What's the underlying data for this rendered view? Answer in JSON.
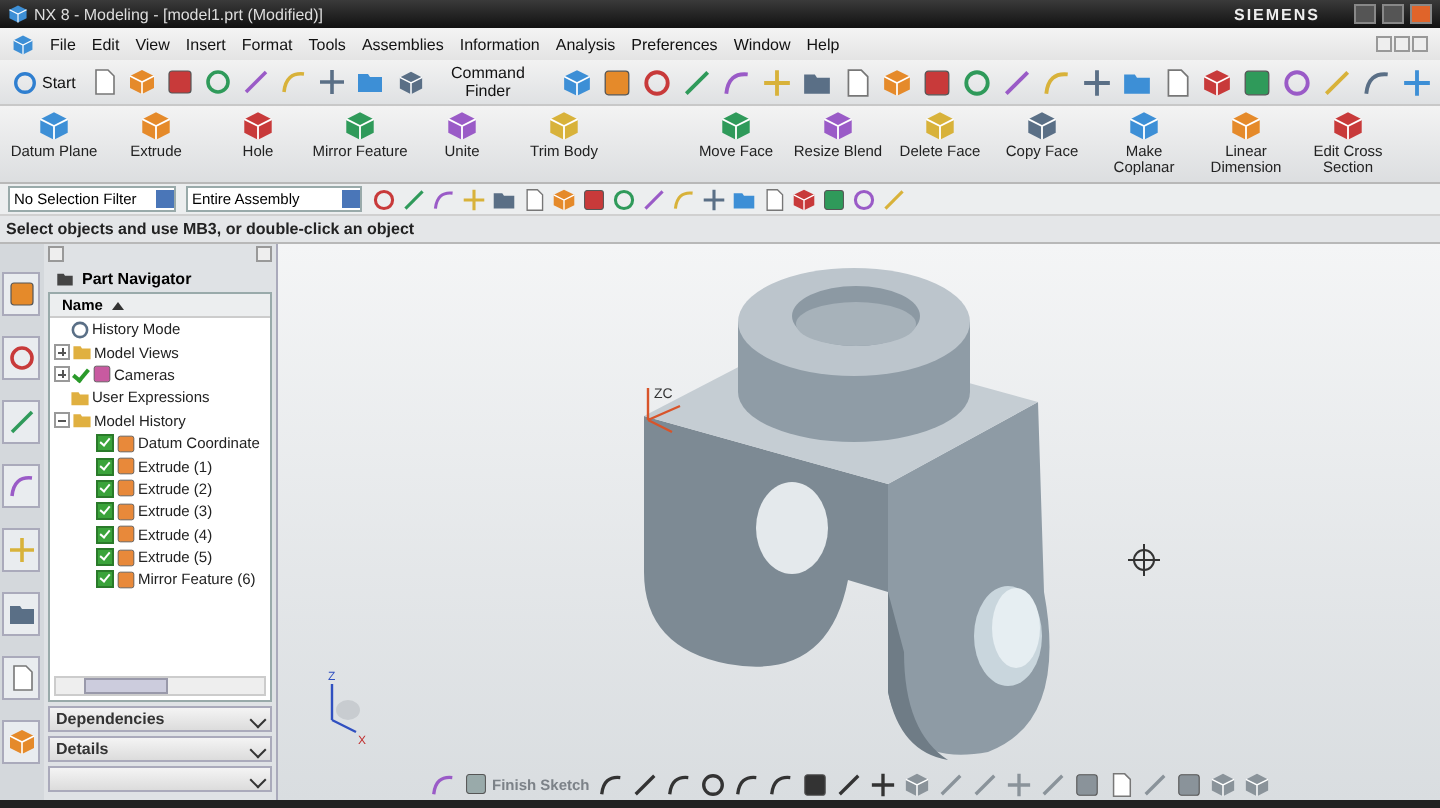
{
  "window": {
    "title": "NX 8 - Modeling - [model1.prt (Modified)]",
    "brand": "SIEMENS"
  },
  "menu": [
    "File",
    "Edit",
    "View",
    "Insert",
    "Format",
    "Tools",
    "Assemblies",
    "Information",
    "Analysis",
    "Preferences",
    "Window",
    "Help"
  ],
  "standard_toolbar": {
    "start": "Start",
    "command_finder": "Command Finder"
  },
  "feature_toolbar": [
    {
      "buttons": [
        "Datum Plane",
        "Extrude",
        "Hole",
        "Mirror Feature",
        "Unite",
        "Trim Body"
      ]
    },
    {
      "buttons": [
        "Move Face",
        "Resize Blend",
        "Delete Face",
        "Copy Face",
        "Make Coplanar",
        "Linear Dimension",
        "Edit Cross Section"
      ]
    }
  ],
  "selection_bar": {
    "filter": "No Selection Filter",
    "scope": "Entire Assembly"
  },
  "cue_line": "Select objects and use MB3, or double-click an object",
  "navigator": {
    "title": "Part Navigator",
    "column": "Name",
    "tree": [
      {
        "label": "History Mode",
        "kind": "mode"
      },
      {
        "label": "Model Views",
        "kind": "folder",
        "expanded": false
      },
      {
        "label": "Cameras",
        "kind": "camera",
        "expanded": false,
        "checked": true
      },
      {
        "label": "User Expressions",
        "kind": "folder"
      },
      {
        "label": "Model History",
        "kind": "folder",
        "expanded": true,
        "children": [
          {
            "label": "Datum Coordinate",
            "kind": "feature",
            "checked": true
          },
          {
            "label": "Extrude (1)",
            "kind": "feature",
            "checked": true
          },
          {
            "label": "Extrude (2)",
            "kind": "feature",
            "checked": true
          },
          {
            "label": "Extrude (3)",
            "kind": "feature",
            "checked": true
          },
          {
            "label": "Extrude (4)",
            "kind": "feature",
            "checked": true
          },
          {
            "label": "Extrude (5)",
            "kind": "feature",
            "checked": true
          },
          {
            "label": "Mirror Feature (6)",
            "kind": "feature",
            "checked": true
          }
        ]
      }
    ]
  },
  "panels": [
    {
      "title": "Dependencies",
      "expanded": false
    },
    {
      "title": "Details",
      "expanded": false
    }
  ],
  "viewport": {
    "triad_label": "ZC",
    "view_triad": {
      "z": "Z",
      "x": "X"
    }
  },
  "sketch_toolbar": {
    "finish": "Finish Sketch",
    "disabled": true
  }
}
